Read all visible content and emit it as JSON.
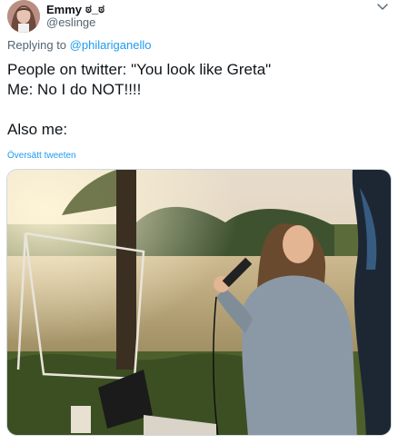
{
  "tweet": {
    "display_name": "Emmy",
    "name_emoji": "ಠ_ಠ",
    "handle": "@eslinge",
    "replying_prefix": "Replying to",
    "replying_to": "@philariganello",
    "text": "People on twitter: \"You look like Greta\"\nMe: No I do NOT!!!!\n\nAlso me:",
    "translate_label": "Översätt tweeten",
    "menu_icon": "chevron-down-icon",
    "avatar_icon": "profile-avatar",
    "media_icon": "photo"
  },
  "colors": {
    "link": "#1d9bf0",
    "secondary_text": "#536471",
    "primary_text": "#0f1419"
  }
}
